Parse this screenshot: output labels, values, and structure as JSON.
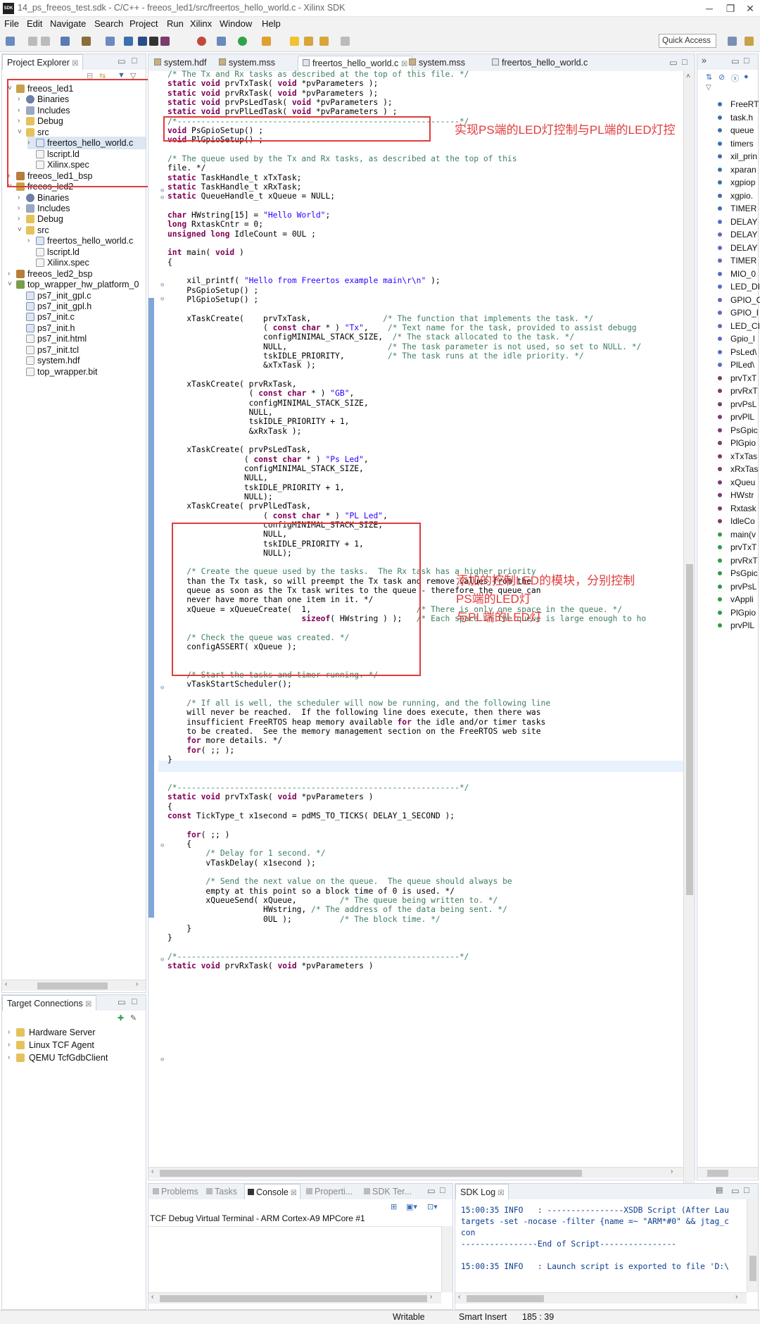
{
  "window": {
    "title": "14_ps_freeos_test.sdk - C/C++ - freeos_led1/src/freertos_hello_world.c - Xilinx SDK",
    "icon": "SDK"
  },
  "menu": [
    "File",
    "Edit",
    "Navigate",
    "Search",
    "Project",
    "Run",
    "Xilinx",
    "Window",
    "Help"
  ],
  "quick_access": "Quick Access",
  "project_explorer": {
    "title": "Project Explorer",
    "tree": [
      {
        "label": "freeos_led1",
        "icon": "proj",
        "indent": 0,
        "twisty": "v"
      },
      {
        "label": "Binaries",
        "icon": "bin",
        "indent": 1,
        "twisty": ">"
      },
      {
        "label": "Includes",
        "icon": "inc",
        "indent": 1,
        "twisty": ">"
      },
      {
        "label": "Debug",
        "icon": "fold",
        "indent": 1,
        "twisty": ">"
      },
      {
        "label": "src",
        "icon": "fold",
        "indent": 1,
        "twisty": "v"
      },
      {
        "label": "freertos_hello_world.c",
        "icon": "cfile",
        "indent": 2,
        "twisty": ">",
        "selected": true
      },
      {
        "label": "lscript.ld",
        "icon": "file",
        "indent": 2,
        "twisty": ""
      },
      {
        "label": "Xilinx.spec",
        "icon": "file",
        "indent": 2,
        "twisty": ""
      },
      {
        "label": "freeos_led1_bsp",
        "icon": "bsp",
        "indent": 0,
        "twisty": ">"
      },
      {
        "label": "freeos_led2",
        "icon": "proj",
        "indent": 0,
        "twisty": "v"
      },
      {
        "label": "Binaries",
        "icon": "bin",
        "indent": 1,
        "twisty": ">"
      },
      {
        "label": "Includes",
        "icon": "inc",
        "indent": 1,
        "twisty": ">"
      },
      {
        "label": "Debug",
        "icon": "fold",
        "indent": 1,
        "twisty": ">"
      },
      {
        "label": "src",
        "icon": "fold",
        "indent": 1,
        "twisty": "v"
      },
      {
        "label": "freertos_hello_world.c",
        "icon": "cfile",
        "indent": 2,
        "twisty": ">"
      },
      {
        "label": "lscript.ld",
        "icon": "file",
        "indent": 2,
        "twisty": ""
      },
      {
        "label": "Xilinx.spec",
        "icon": "file",
        "indent": 2,
        "twisty": ""
      },
      {
        "label": "freeos_led2_bsp",
        "icon": "bsp",
        "indent": 0,
        "twisty": ">"
      },
      {
        "label": "top_wrapper_hw_platform_0",
        "icon": "plat",
        "indent": 0,
        "twisty": "v"
      },
      {
        "label": "ps7_init_gpl.c",
        "icon": "cfile",
        "indent": 1,
        "twisty": ""
      },
      {
        "label": "ps7_init_gpl.h",
        "icon": "cfile",
        "indent": 1,
        "twisty": ""
      },
      {
        "label": "ps7_init.c",
        "icon": "cfile",
        "indent": 1,
        "twisty": ""
      },
      {
        "label": "ps7_init.h",
        "icon": "cfile",
        "indent": 1,
        "twisty": ""
      },
      {
        "label": "ps7_init.html",
        "icon": "file",
        "indent": 1,
        "twisty": ""
      },
      {
        "label": "ps7_init.tcl",
        "icon": "file",
        "indent": 1,
        "twisty": ""
      },
      {
        "label": "system.hdf",
        "icon": "file",
        "indent": 1,
        "twisty": ""
      },
      {
        "label": "top_wrapper.bit",
        "icon": "file",
        "indent": 1,
        "twisty": ""
      }
    ]
  },
  "target_connections": {
    "title": "Target Connections",
    "items": [
      "Hardware Server",
      "Linux TCF Agent",
      "QEMU TcfGdbClient"
    ]
  },
  "editor_tabs": [
    {
      "label": "system.hdf",
      "active": false
    },
    {
      "label": "system.mss",
      "active": false
    },
    {
      "label": "freertos_hello_world.c",
      "active": true
    },
    {
      "label": "system.mss",
      "active": false
    },
    {
      "label": "freertos_hello_world.c",
      "active": false
    }
  ],
  "code": [
    "/* The Tx and Rx tasks as described at the top of this file. */",
    "static void prvTxTask( void *pvParameters );",
    "static void prvRxTask( void *pvParameters );",
    "static void prvPsLedTask( void *pvParameters );",
    "static void prvPlLedTask( void *pvParameters ) ;",
    "/*-----------------------------------------------------------*/",
    "void PsGpioSetup() ;",
    "void PlGpioSetup() ;",
    "",
    "/* The queue used by the Tx and Rx tasks, as described at the top of this",
    "file. */",
    "static TaskHandle_t xTxTask;",
    "static TaskHandle_t xRxTask;",
    "static QueueHandle_t xQueue = NULL;",
    "",
    "char HWstring[15] = \"Hello World\";",
    "long RxtaskCntr = 0;",
    "unsigned long IdleCount = 0UL ;",
    "",
    "int main( void )",
    "{",
    "",
    "    xil_printf( \"Hello from Freertos example main\\r\\n\" );",
    "    PsGpioSetup() ;",
    "    PlGpioSetup() ;",
    "",
    "    xTaskCreate(    prvTxTask,               /* The function that implements the task. */",
    "                    ( const char * ) \"Tx\",    /* Text name for the task, provided to assist debugg",
    "                    configMINIMAL_STACK_SIZE,  /* The stack allocated to the task. */",
    "                    NULL,                     /* The task parameter is not used, so set to NULL. */",
    "                    tskIDLE_PRIORITY,         /* The task runs at the idle priority. */",
    "                    &xTxTask );",
    "",
    "    xTaskCreate( prvRxTask,",
    "                 ( const char * ) \"GB\",",
    "                 configMINIMAL_STACK_SIZE,",
    "                 NULL,",
    "                 tskIDLE_PRIORITY + 1,",
    "                 &xRxTask );",
    "",
    "    xTaskCreate( prvPsLedTask,",
    "                ( const char * ) \"Ps Led\",",
    "                configMINIMAL_STACK_SIZE,",
    "                NULL,",
    "                tskIDLE_PRIORITY + 1,",
    "                NULL);",
    "    xTaskCreate( prvPlLedTask,",
    "                    ( const char * ) \"PL Led\",",
    "                    configMINIMAL_STACK_SIZE,",
    "                    NULL,",
    "                    tskIDLE_PRIORITY + 1,",
    "                    NULL);",
    "",
    "    /* Create the queue used by the tasks.  The Rx task has a higher priority",
    "    than the Tx task, so will preempt the Tx task and remove values from the",
    "    queue as soon as the Tx task writes to the queue - therefore the queue can",
    "    never have more than one item in it. */",
    "    xQueue = xQueueCreate(  1,                      /* There is only one space in the queue. */",
    "                            sizeof( HWstring ) );   /* Each space in the queue is large enough to ho",
    "",
    "    /* Check the queue was created. */",
    "    configASSERT( xQueue );",
    "",
    "",
    "    /* Start the tasks and timer running. */",
    "    vTaskStartScheduler();",
    "",
    "    /* If all is well, the scheduler will now be running, and the following line",
    "    will never be reached.  If the following line does execute, then there was",
    "    insufficient FreeRTOS heap memory available for the idle and/or timer tasks",
    "    to be created.  See the memory management section on the FreeRTOS web site",
    "    for more details. */",
    "    for( ;; );",
    "}",
    "",
    "",
    "/*-----------------------------------------------------------*/",
    "static void prvTxTask( void *pvParameters )",
    "{",
    "const TickType_t x1second = pdMS_TO_TICKS( DELAY_1_SECOND );",
    "",
    "    for( ;; )",
    "    {",
    "        /* Delay for 1 second. */",
    "        vTaskDelay( x1second );",
    "",
    "        /* Send the next value on the queue.  The queue should always be",
    "        empty at this point so a block time of 0 is used. */",
    "        xQueueSend( xQueue,         /* The queue being written to. */",
    "                    HWstring, /* The address of the data being sent. */",
    "                    0UL );          /* The block time. */",
    "    }",
    "}",
    "",
    "/*-----------------------------------------------------------*/",
    "static void prvRxTask( void *pvParameters )"
  ],
  "annotations": {
    "top": "实现PS端的LED灯控制与PL端的LED灯控",
    "middle": "添加的控制LED的模块，分别控制\nPS端的LED灯\n与PL端的LED灯"
  },
  "outline": [
    "FreeRT",
    "task.h",
    "queue",
    "timers",
    "xil_prin",
    "xparan",
    "xgpiop",
    "xgpio.",
    "TIMER",
    "DELAY",
    "DELAY",
    "DELAY",
    "TIMER",
    "MIO_0",
    "LED_DI",
    "GPIO_C",
    "GPIO_I",
    "LED_CI",
    "Gpio_l",
    "PsLed\\",
    "PlLed\\",
    "prvTxT",
    "prvRxT",
    "prvPsL",
    "prvPlL",
    "PsGpic",
    "PlGpio",
    "xTxTas",
    "xRxTas",
    "xQueu",
    "HWstr",
    "Rxtask",
    "IdleCo",
    "main(v",
    "prvTxT",
    "prvRxT",
    "PsGpic",
    "prvPsL",
    "vAppli",
    "PlGpio",
    "prvPlL"
  ],
  "bottom_tabs": [
    "Problems",
    "Tasks",
    "Console",
    "Properti...",
    "SDK Ter..."
  ],
  "console": {
    "title": "TCF Debug Virtual Terminal - ARM Cortex-A9 MPCore #1"
  },
  "sdk_log": {
    "title": "SDK Log",
    "lines": [
      "15:00:35 INFO   : ----------------XSDB Script (After Lau",
      "targets -set -nocase -filter {name =~ \"ARM*#0\" && jtag_c",
      "con",
      "----------------End of Script----------------",
      "",
      "15:00:35 INFO   : Launch script is exported to file 'D:\\"
    ]
  },
  "status": {
    "writable": "Writable",
    "insert": "Smart Insert",
    "position": "185 : 39"
  }
}
